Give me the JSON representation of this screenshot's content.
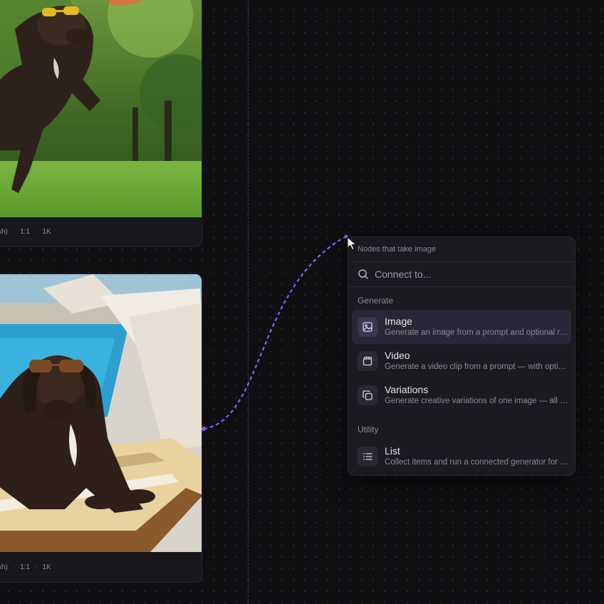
{
  "nodes": [
    {
      "meta": [
        "sh)",
        "1:1",
        "1K"
      ],
      "image_alt": "Brown labrador wearing yellow sunglasses leaping for a frisbee on a sunny lawn"
    },
    {
      "meta": [
        "sh)",
        "1:1",
        "1K"
      ],
      "image_alt": "Brown labrador wearing sunglasses lounging on a striped towel on a poolside deck chair"
    }
  ],
  "menu": {
    "header": "Nodes that take image",
    "search_placeholder": "Connect to...",
    "sections": [
      {
        "label": "Generate",
        "items": [
          {
            "title": "Image",
            "desc": "Generate an image from a prompt and optional references",
            "icon": "image-icon",
            "active": true
          },
          {
            "title": "Video",
            "desc": "Generate a video clip from a prompt — with optional frames",
            "icon": "video-icon",
            "active": false
          },
          {
            "title": "Variations",
            "desc": "Generate creative variations of one image — all at once",
            "icon": "variations-icon",
            "active": false
          }
        ]
      },
      {
        "label": "Utility",
        "items": [
          {
            "title": "List",
            "desc": "Collect items and run a connected generator for each item",
            "icon": "list-icon",
            "active": false
          }
        ]
      }
    ]
  },
  "colors": {
    "canvas": "#0f0f12",
    "wire": "#8b5cf6",
    "menu_bg": "#1b1a21",
    "active_item": "#2a2638"
  }
}
